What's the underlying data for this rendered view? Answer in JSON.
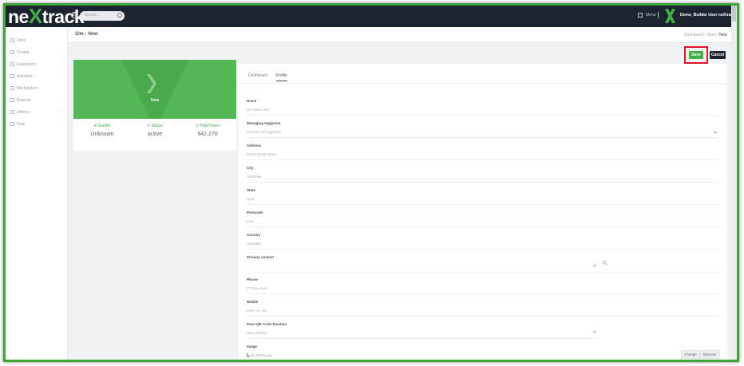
{
  "app": {
    "logo_prefix": "ne",
    "logo_x": "X",
    "logo_suffix": "track",
    "reg_mark": "®",
    "search_placeholder": "Search..."
  },
  "header": {
    "menu_label": "Menu",
    "user_name": "Demo_Builder User neXtrack"
  },
  "sidebar": {
    "items": [
      {
        "label": "Sites",
        "icon": "pin-icon",
        "chevron": false
      },
      {
        "label": "People",
        "icon": "person-icon",
        "chevron": true
      },
      {
        "label": "Equipment",
        "icon": "equipment-icon",
        "chevron": true
      },
      {
        "label": "Activities",
        "icon": "activities-icon",
        "chevron": true
      },
      {
        "label": "Marketplace",
        "icon": "marketplace-icon",
        "chevron": false
      },
      {
        "label": "Reports",
        "icon": "reports-icon",
        "chevron": true
      },
      {
        "label": "Utilities",
        "icon": "wrench-icon",
        "chevron": true
      },
      {
        "label": "Help",
        "icon": "help-icon",
        "chevron": true
      }
    ]
  },
  "page": {
    "title": "Site : New",
    "breadcrumb": [
      "Dashboard",
      "Sites",
      "New"
    ]
  },
  "actions": {
    "save": "Save",
    "cancel": "Cancel"
  },
  "profile": {
    "name": "New",
    "stats": [
      {
        "label": "Builder",
        "value": "Unknown"
      },
      {
        "label": "Status",
        "value": "active"
      },
      {
        "label": "Total Hours",
        "value": "942,270"
      }
    ]
  },
  "tabs": [
    "Dashboard",
    "Profile"
  ],
  "fields": [
    {
      "label": "Name",
      "value": "De MoMo Site"
    },
    {
      "label": "Managing Hygienist",
      "value": "Choose site hygienist"
    },
    {
      "label": "Address",
      "value": "48 De MoMo Drive"
    },
    {
      "label": "City",
      "value": "Testsville"
    },
    {
      "label": "State",
      "value": "QLD"
    },
    {
      "label": "Postcode",
      "value": "4xxx"
    },
    {
      "label": "Country",
      "value": "Australia"
    },
    {
      "label": "Primary contact",
      "value": ""
    },
    {
      "label": "Phone",
      "value": "07 3xxx xxxx"
    },
    {
      "label": "Mobile",
      "value": "04xx xxx xxx"
    },
    {
      "label": "Zone QR Code function",
      "value": "Start activity"
    },
    {
      "label": "Image",
      "value": "De MoMo.jpg"
    }
  ],
  "image_actions": {
    "change": "Change",
    "remove": "Remove"
  },
  "colors": {
    "brand_green": "#43b047",
    "topbar": "#1c2430",
    "highlight": "#e0162b"
  }
}
